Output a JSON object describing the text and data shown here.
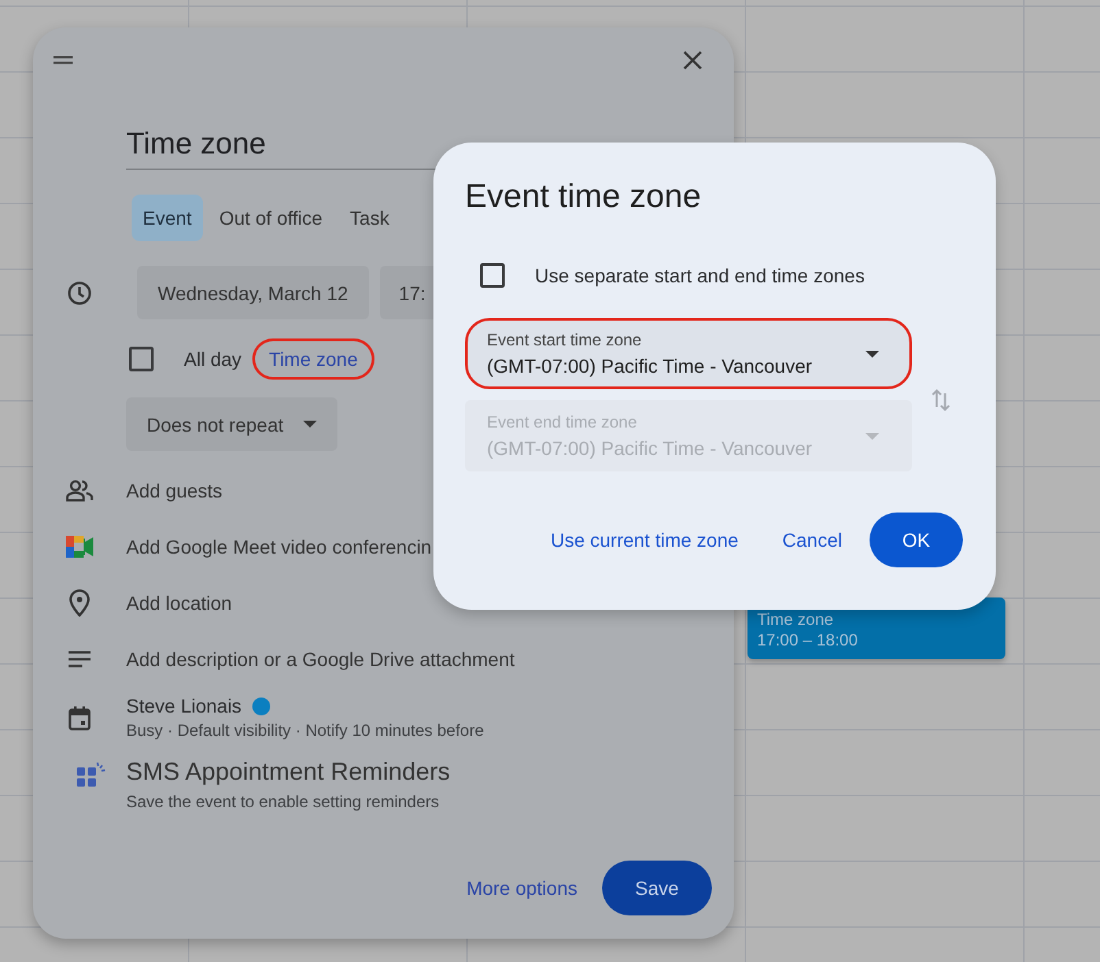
{
  "event_editor": {
    "title": "Time zone",
    "tabs": [
      {
        "label": "Event",
        "selected": true
      },
      {
        "label": "Out of office",
        "selected": false
      },
      {
        "label": "Task",
        "selected": false
      }
    ],
    "start_date": "Wednesday, March 12",
    "start_time": "17:",
    "all_day": {
      "label": "All day",
      "checked": false
    },
    "time_zone_link": {
      "label": "Time zone",
      "highlighted": true
    },
    "recurrence": "Does not repeat",
    "rows": [
      {
        "kind": "guests",
        "label": "Add guests"
      },
      {
        "kind": "meet",
        "label": "Add Google Meet video conferencin"
      },
      {
        "kind": "location",
        "label": "Add location"
      },
      {
        "kind": "description",
        "label": "Add description or a Google Drive attachment"
      }
    ],
    "calendar": {
      "name": "Steve Lionais",
      "color": "#0b7fc0",
      "details": "Busy · Default visibility · Notify 10 minutes before"
    },
    "sms": {
      "title": "SMS Appointment Reminders",
      "subtitle": "Save the event to enable setting reminders"
    },
    "more_options": "More options",
    "save": "Save"
  },
  "dialog": {
    "title": "Event time zone",
    "separate_zones": {
      "label": "Use separate start and end time zones",
      "checked": false
    },
    "zones": [
      {
        "label": "Event start time zone",
        "value": "(GMT-07:00) Pacific Time - Vancouver",
        "disabled": false,
        "highlighted": true
      },
      {
        "label": "Event end time zone",
        "value": "(GMT-07:00) Pacific Time - Vancouver",
        "disabled": true,
        "highlighted": false
      }
    ],
    "buttons": [
      {
        "kind": "link",
        "label": "Use current time zone"
      },
      {
        "kind": "link",
        "label": "Cancel"
      },
      {
        "kind": "primary",
        "label": "OK"
      }
    ]
  },
  "calendar_event": {
    "title": "Time zone",
    "time": "17:00 – 18:00"
  }
}
